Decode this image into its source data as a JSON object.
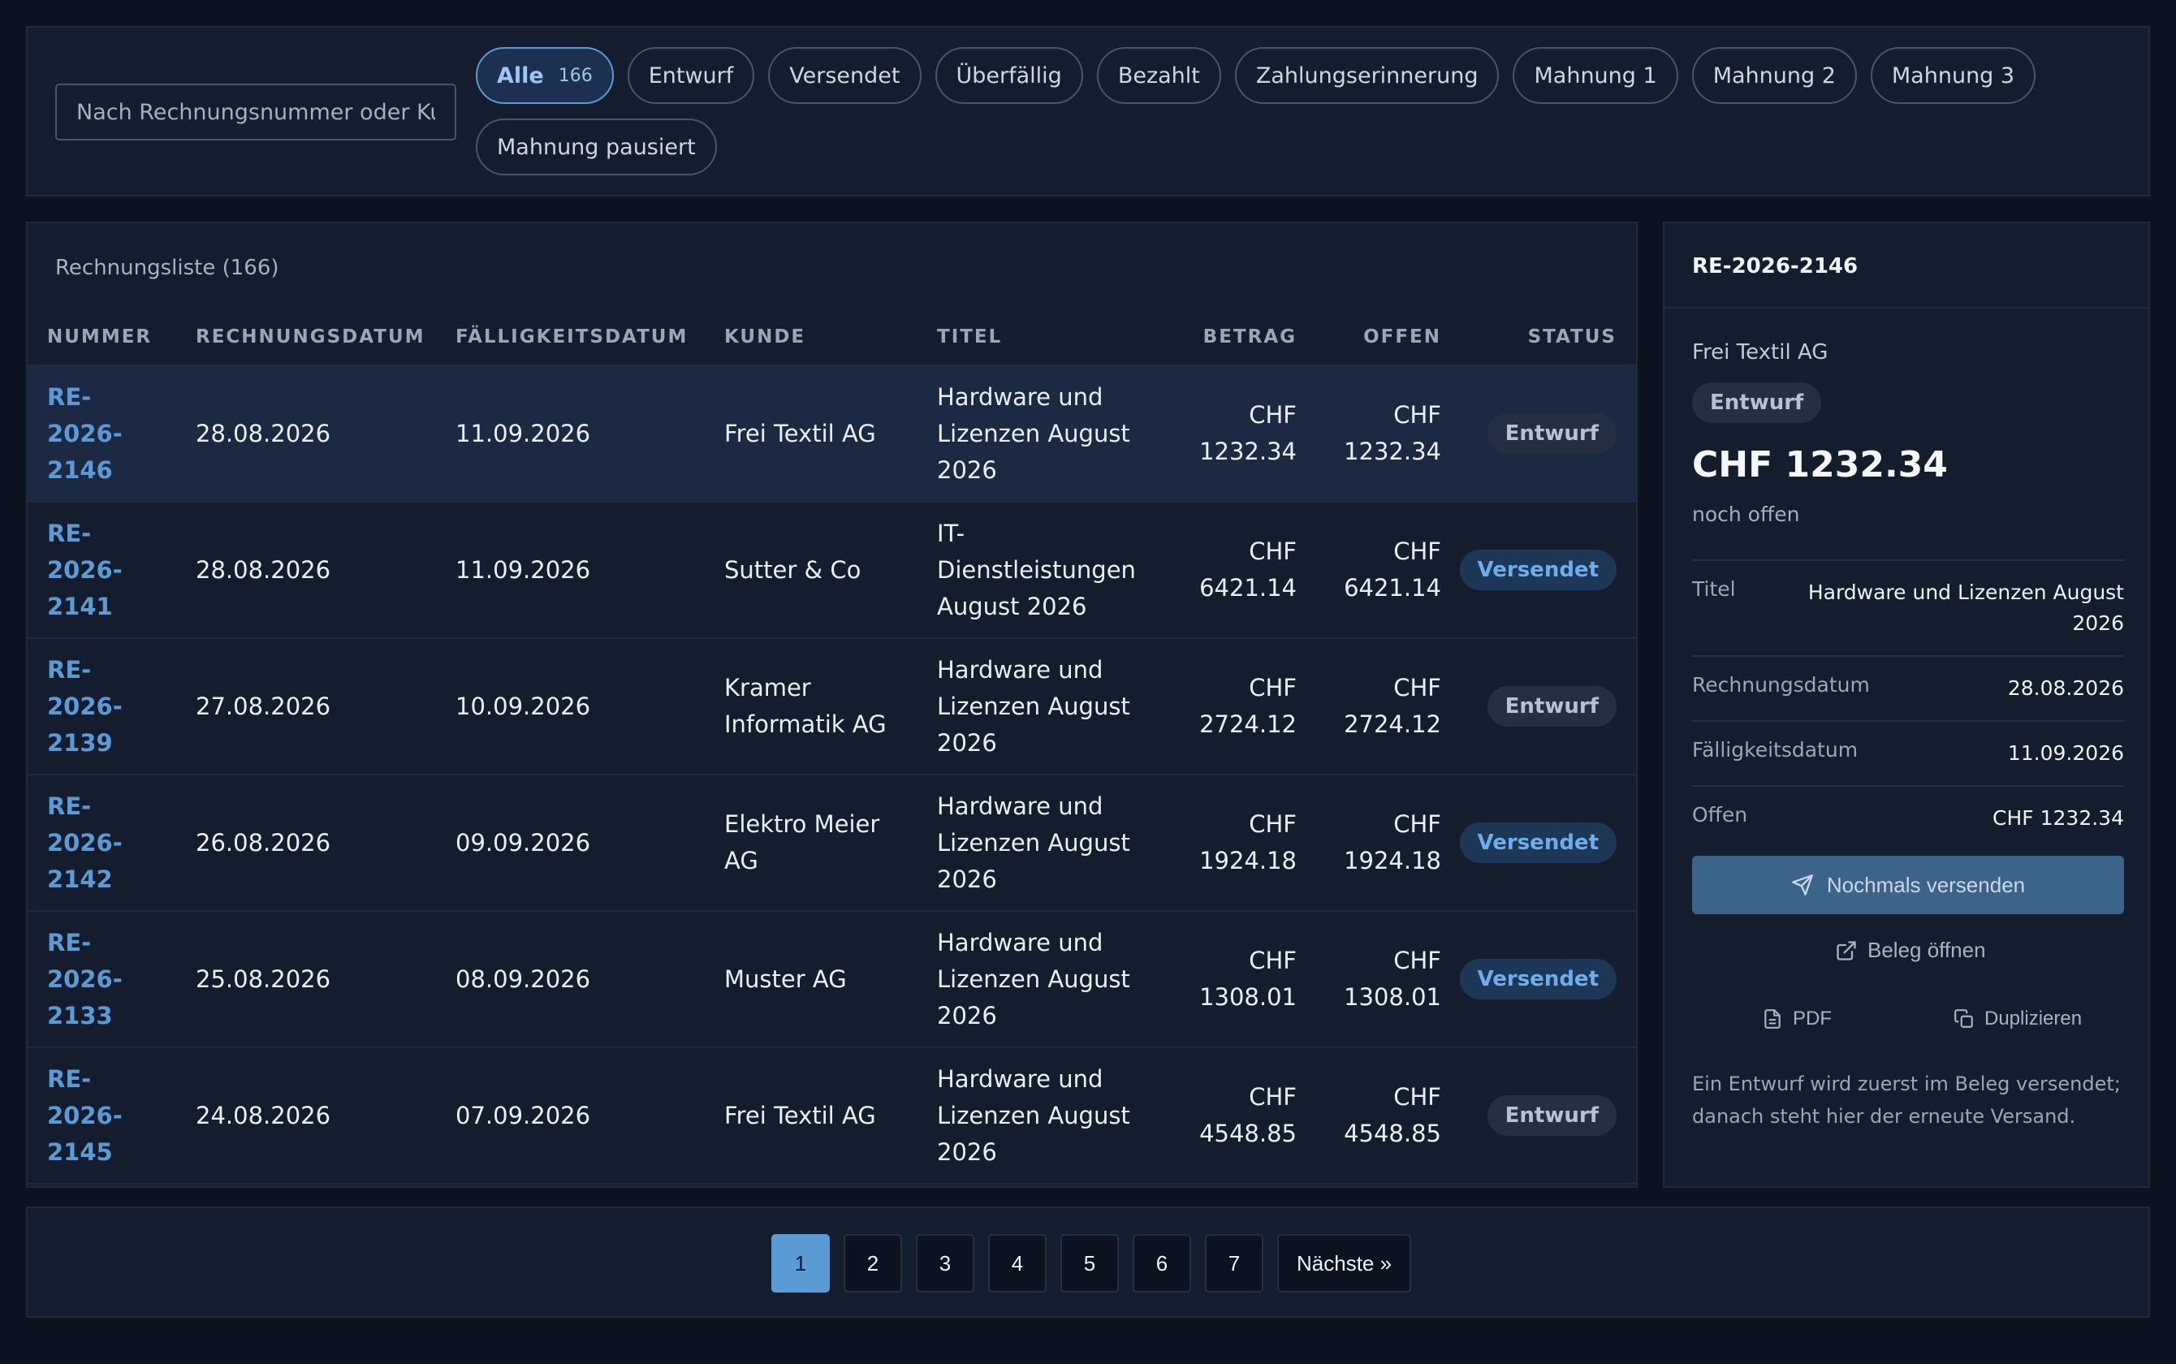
{
  "filter_bar": {
    "search_placeholder": "Nach Rechnungsnummer oder Kunde",
    "chips": [
      {
        "label": "Alle",
        "count": "166",
        "active": true
      },
      {
        "label": "Entwurf"
      },
      {
        "label": "Versendet"
      },
      {
        "label": "Überfällig"
      },
      {
        "label": "Bezahlt"
      },
      {
        "label": "Zahlungserinnerung"
      },
      {
        "label": "Mahnung 1"
      },
      {
        "label": "Mahnung 2"
      },
      {
        "label": "Mahnung 3"
      },
      {
        "label": "Mahnung pausiert"
      }
    ]
  },
  "list": {
    "title": "Rechnungsliste (166)",
    "columns": [
      "NUMMER",
      "RECHNUNGSDATUM",
      "FÄLLIGKEITSDATUM",
      "KUNDE",
      "TITEL",
      "BETRAG",
      "OFFEN",
      "STATUS"
    ],
    "rows": [
      {
        "nummer": "RE-2026-2146",
        "rechnungsdatum": "28.08.2026",
        "faelligkeitsdatum": "11.09.2026",
        "kunde": "Frei Textil AG",
        "titel": "Hardware und Lizenzen August 2026",
        "betrag": "CHF 1232.34",
        "offen": "CHF 1232.34",
        "status": "Entwurf",
        "selected": true
      },
      {
        "nummer": "RE-2026-2141",
        "rechnungsdatum": "28.08.2026",
        "faelligkeitsdatum": "11.09.2026",
        "kunde": "Sutter & Co",
        "titel": "IT-Dienstleistungen August 2026",
        "betrag": "CHF 6421.14",
        "offen": "CHF 6421.14",
        "status": "Versendet"
      },
      {
        "nummer": "RE-2026-2139",
        "rechnungsdatum": "27.08.2026",
        "faelligkeitsdatum": "10.09.2026",
        "kunde": "Kramer Informatik AG",
        "titel": "Hardware und Lizenzen August 2026",
        "betrag": "CHF 2724.12",
        "offen": "CHF 2724.12",
        "status": "Entwurf"
      },
      {
        "nummer": "RE-2026-2142",
        "rechnungsdatum": "26.08.2026",
        "faelligkeitsdatum": "09.09.2026",
        "kunde": "Elektro Meier AG",
        "titel": "Hardware und Lizenzen August 2026",
        "betrag": "CHF 1924.18",
        "offen": "CHF 1924.18",
        "status": "Versendet"
      },
      {
        "nummer": "RE-2026-2133",
        "rechnungsdatum": "25.08.2026",
        "faelligkeitsdatum": "08.09.2026",
        "kunde": "Muster AG",
        "titel": "Hardware und Lizenzen August 2026",
        "betrag": "CHF 1308.01",
        "offen": "CHF 1308.01",
        "status": "Versendet"
      },
      {
        "nummer": "RE-2026-2145",
        "rechnungsdatum": "24.08.2026",
        "faelligkeitsdatum": "07.09.2026",
        "kunde": "Frei Textil AG",
        "titel": "Hardware und Lizenzen August 2026",
        "betrag": "CHF 4548.85",
        "offen": "CHF 4548.85",
        "status": "Entwurf"
      }
    ]
  },
  "detail": {
    "invoice_number": "RE-2026-2146",
    "customer": "Frei Textil AG",
    "status": "Entwurf",
    "amount": "CHF 1232.34",
    "amount_caption": "noch offen",
    "fields": [
      {
        "label": "Titel",
        "value": "Hardware und Lizenzen August 2026"
      },
      {
        "label": "Rechnungsdatum",
        "value": "28.08.2026"
      },
      {
        "label": "Fälligkeitsdatum",
        "value": "11.09.2026"
      },
      {
        "label": "Offen",
        "value": "CHF 1232.34"
      }
    ],
    "resend_label": "Nochmals versenden",
    "open_label": "Beleg öffnen",
    "pdf_label": "PDF",
    "duplicate_label": "Duplizieren",
    "hint": "Ein Entwurf wird zuerst im Beleg versendet; danach steht hier der erneute Versand."
  },
  "pagination": {
    "pages": [
      "1",
      "2",
      "3",
      "4",
      "5",
      "6",
      "7"
    ],
    "current": "1",
    "next_label": "Nächste »"
  },
  "colors": {
    "background": "#0c1220",
    "panel": "#141d2d",
    "accent": "#5b9bd5",
    "sent_badge": "#1d3857",
    "draft_badge": "#243042"
  }
}
